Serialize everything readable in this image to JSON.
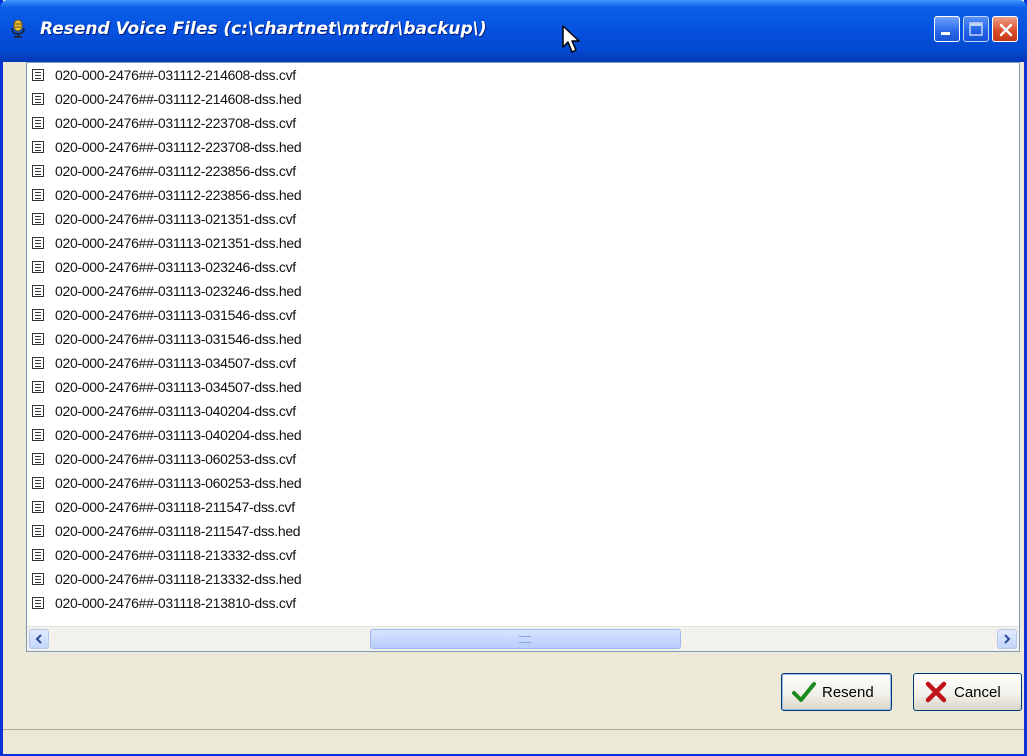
{
  "window": {
    "title": "Resend Voice Files (c:\\chartnet\\mtrdr\\backup\\)"
  },
  "file_list": {
    "items": [
      "020-000-2476##-031112-214608-dss.cvf",
      "020-000-2476##-031112-214608-dss.hed",
      "020-000-2476##-031112-223708-dss.cvf",
      "020-000-2476##-031112-223708-dss.hed",
      "020-000-2476##-031112-223856-dss.cvf",
      "020-000-2476##-031112-223856-dss.hed",
      "020-000-2476##-031113-021351-dss.cvf",
      "020-000-2476##-031113-021351-dss.hed",
      "020-000-2476##-031113-023246-dss.cvf",
      "020-000-2476##-031113-023246-dss.hed",
      "020-000-2476##-031113-031546-dss.cvf",
      "020-000-2476##-031113-031546-dss.hed",
      "020-000-2476##-031113-034507-dss.cvf",
      "020-000-2476##-031113-034507-dss.hed",
      "020-000-2476##-031113-040204-dss.cvf",
      "020-000-2476##-031113-040204-dss.hed",
      "020-000-2476##-031113-060253-dss.cvf",
      "020-000-2476##-031113-060253-dss.hed",
      "020-000-2476##-031118-211547-dss.cvf",
      "020-000-2476##-031118-211547-dss.hed",
      "020-000-2476##-031118-213332-dss.cvf",
      "020-000-2476##-031118-213332-dss.hed",
      "020-000-2476##-031118-213810-dss.cvf"
    ],
    "item_icon": "document-icon"
  },
  "buttons": {
    "resend_label": "Resend",
    "resend_icon": "checkmark-icon",
    "cancel_label": "Cancel",
    "cancel_icon": "red-x-icon"
  },
  "colors": {
    "titlebar": "#0553e0",
    "window_bg": "#ece9d8",
    "close_button": "#d94a26",
    "checkmark": "#1c8a1c",
    "cancel_x": "#c0131b"
  }
}
